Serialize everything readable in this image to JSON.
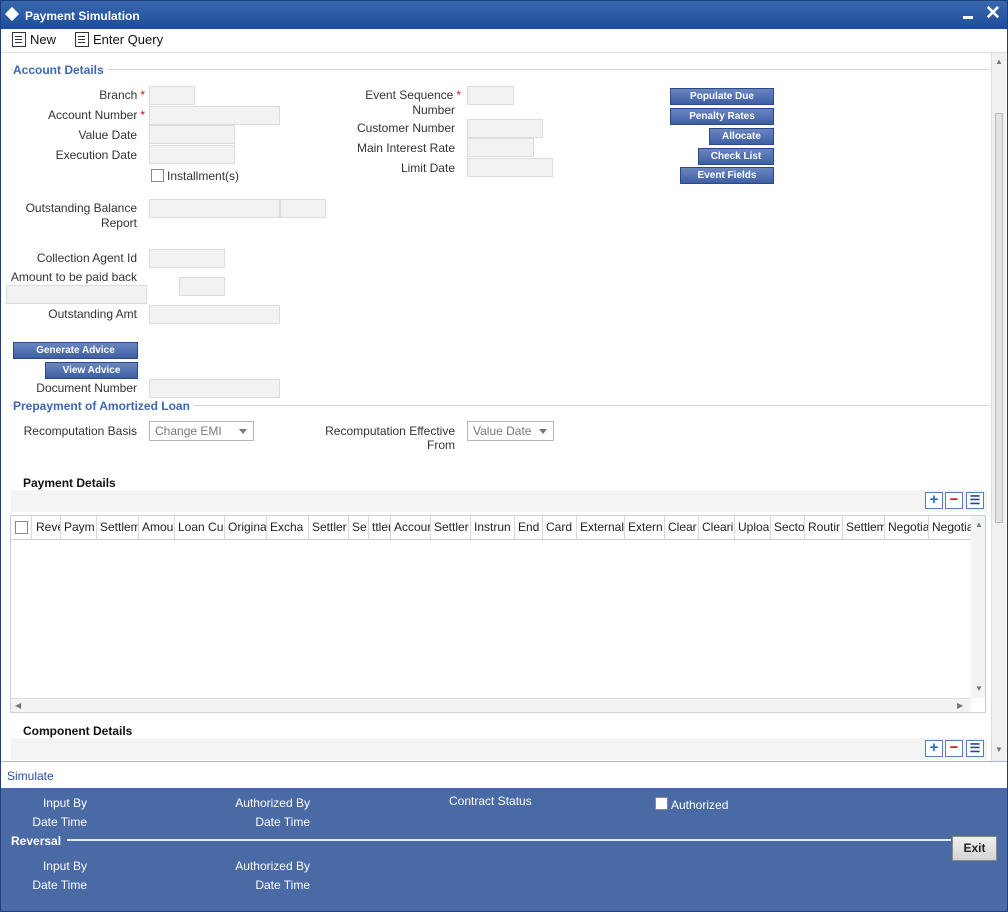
{
  "window": {
    "title": "Payment Simulation"
  },
  "toolbar": {
    "new_label": "New",
    "enter_query_label": "Enter Query"
  },
  "account_details": {
    "section_title": "Account Details",
    "branch_label": "Branch",
    "account_number_label": "Account Number",
    "value_date_label": "Value Date",
    "execution_date_label": "Execution Date",
    "installments_label": "Installment(s)",
    "event_sequence_label_1": "Event Sequence",
    "event_sequence_label_2": "Number",
    "customer_number_label": "Customer Number",
    "main_interest_rate_label": "Main Interest Rate",
    "limit_date_label": "Limit Date",
    "outstanding_balance_label_1": "Outstanding Balance",
    "outstanding_balance_label_2": "Report",
    "collection_agent_label": "Collection Agent Id",
    "amount_paid_back_label": "Amount to be paid back",
    "outstanding_amt_label": "Outstanding Amt",
    "document_number_label": "Document Number",
    "required_mark": "*"
  },
  "side_buttons": {
    "populate_due": "Populate Due",
    "penalty_rates": "Penalty Rates",
    "allocate": "Allocate",
    "check_list": "Check List",
    "event_fields": "Event Fields"
  },
  "advice_buttons": {
    "generate_advice": "Generate Advice",
    "view_advice": "View Advice"
  },
  "prepayment": {
    "section_title": "Prepayment of Amortized Loan",
    "recomputation_basis_label": "Recomputation Basis",
    "recomputation_basis_value": "Change EMI",
    "recomputation_effective_label_1": "Recomputation Effective",
    "recomputation_effective_label_2": "From",
    "recomputation_effective_value": "Value Date"
  },
  "payment_details": {
    "title": "Payment Details",
    "columns": [
      "Reve",
      "Paym",
      "Settlem",
      "Amou",
      "Loan Cu",
      "Origina",
      "Excha",
      "Settler",
      "Se",
      "ttler",
      "Accour",
      "Settler",
      "Instrun",
      "End",
      "Card",
      "External",
      "Extern",
      "Clear",
      "Cleari",
      "Uploa",
      "Secto",
      "Routir",
      "Settlem",
      "Negotia",
      "Negotia"
    ]
  },
  "component_details": {
    "title": "Component Details"
  },
  "simulate": {
    "label": "Simulate"
  },
  "footer": {
    "input_by": "Input By",
    "date_time": "Date Time",
    "authorized_by": "Authorized By",
    "contract_status": "Contract Status",
    "authorized": "Authorized",
    "reversal": "Reversal",
    "exit": "Exit"
  },
  "colors": {
    "title_bar": "#1f4c97",
    "section_text": "#3f67b1",
    "footer": "#4a6aa5",
    "button": "#3e5fa3"
  },
  "icons": [
    "new-icon",
    "enter-query-icon",
    "window-diamond-icon",
    "minimize-icon",
    "close-icon",
    "add-row-icon",
    "delete-row-icon",
    "single-view-icon"
  ]
}
